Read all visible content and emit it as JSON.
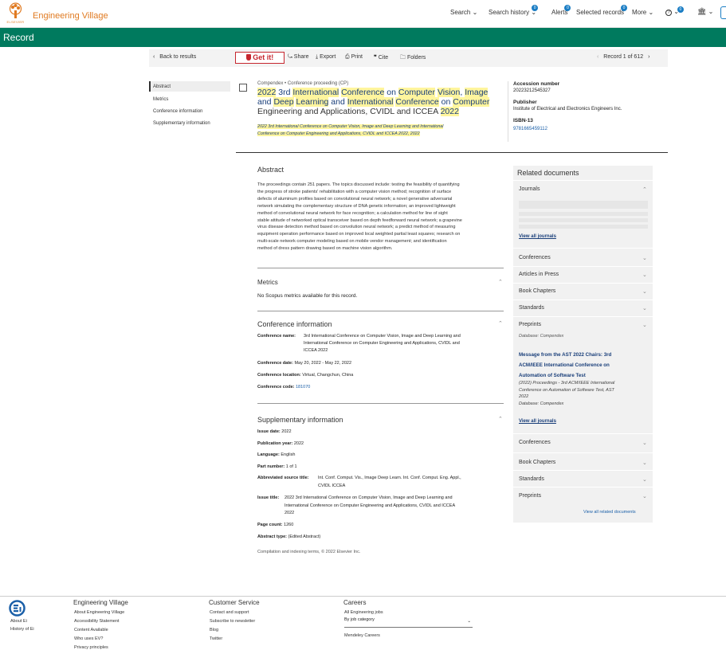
{
  "header": {
    "elsevier_label": "ELSEVIER",
    "brand": "Engineering Village",
    "nav": {
      "search": "Search",
      "search_history": "Search history",
      "alerts": "Alerts",
      "selected_records": "Selected records",
      "more": "More"
    },
    "badges": {
      "search_history": "0",
      "alerts": "0",
      "selected_records": "0",
      "help": "0"
    }
  },
  "page_title": "Record",
  "toolbar": {
    "back": "Back to results",
    "getit": "Get it!",
    "share": "Share",
    "export": "Export",
    "print": "Print",
    "cite": "Cite",
    "folders": "Folders",
    "record_position": "Record 1 of 612"
  },
  "side_nav": [
    "Abstract",
    "Metrics",
    "Conference information",
    "Supplementary information"
  ],
  "record": {
    "source": "Compendex",
    "doc_type": "Conference proceeding (CP)",
    "title_parts": [
      "2022",
      " 3rd ",
      "International",
      " ",
      "Conference",
      " on ",
      "Computer",
      " ",
      "Vision",
      ", ",
      "Image",
      " and ",
      "Deep",
      " ",
      "Learning",
      " and ",
      "International",
      " ",
      "Conference",
      " on ",
      "Computer",
      " Engineering and Applications, CVIDL and ICCEA ",
      "2022"
    ],
    "subtitle_line1": "2022 3rd International Conference on Computer Vision, Image and Deep Learning and International",
    "subtitle_line2": "Conference on Computer Engineering and Applications, CVIDL and ICCEA 2022, 2022"
  },
  "meta": {
    "accession_label": "Accession number",
    "accession_value": "20223212545327",
    "publisher_label": "Publisher",
    "publisher_value": "Institute of Electrical and Electronics Engineers Inc.",
    "isbn_label": "ISBN-13",
    "isbn_value": "9781665459112"
  },
  "abstract": {
    "title": "Abstract",
    "lines": [
      "The proceedings contain 251 papers. The topics discussed include: testing the feasibility of quantifying",
      "the progress of stroke patients' rehabilitation with a computer vision method; recognition of surface",
      "defects of aluminum profiles based on convolutional neural network; a novel generative adversarial",
      "network simulating the complementary structure of DNA genetic information; an improved lightweight",
      "method of convolutional neural network for face recognition; a calculation method for line of sight",
      "stable attitude of networked optical transceiver based on depth feedforward neural network; a grapevine",
      "virus disease detection method based on convolution neural network; a predict method of measuring",
      "equipment operation performance based on improved local weighted partial least squares; research on",
      "multi-scale network computer modeling based on mobile vendor management; and identification",
      "method of dress pattern drawing based on machine vision algorithm."
    ]
  },
  "metrics": {
    "title": "Metrics",
    "text": "No Scopus metrics available for this record."
  },
  "conference": {
    "title": "Conference information",
    "name_label": "Conference name:",
    "name_line1": "3rd International Conference on Computer Vision, Image and Deep Learning and",
    "name_line2": "International Conference on Computer Engineering and Applications, CVIDL and",
    "name_line3": "ICCEA 2022",
    "date_label": "Conference date:",
    "date_value": "May 20, 2022 - May 22, 2022",
    "location_label": "Conference location:",
    "location_value": "Virtual, Changchun, China",
    "code_label": "Conference code:",
    "code_value": "181070"
  },
  "supplementary": {
    "title": "Supplementary information",
    "issue_date_label": "Issue date:",
    "issue_date_value": "2022",
    "pub_year_label": "Publication year:",
    "pub_year_value": "2022",
    "language_label": "Language:",
    "language_value": "English",
    "part_label": "Part number:",
    "part_value": "1 of 1",
    "abbrev_label": "Abbreviated source title:",
    "abbrev_line1": "Int. Conf. Comput. Vis., Image Deep Learn. Int. Conf. Comput. Eng. Appl.,",
    "abbrev_line2": "CVIDL ICCEA",
    "issue_title_label": "Issue title:",
    "issue_title_line1": "2022 3rd International Conference on Computer Vision, Image and Deep Learning and",
    "issue_title_line2": "International Conference on Computer Engineering and Applications, CVIDL and ICCEA",
    "issue_title_line3": "2022",
    "page_count_label": "Page count:",
    "page_count_value": "1260",
    "abstract_type_label": "Abstract type:",
    "abstract_type_value": "(Edited Abstract)",
    "copyright": "Compilation and indexing terms, © 2022 Elsevier Inc."
  },
  "related": {
    "title": "Related documents",
    "journals": "Journals",
    "view_all_journals": "View all journals",
    "conferences": "Conferences",
    "articles_in_press": "Articles in Press",
    "book_chapters": "Book Chapters",
    "standards": "Standards",
    "preprints": "Preprints",
    "db_label": "Database: Compendex",
    "item_title_line1": "Message from the AST 2022 Chairs: 3rd",
    "item_title_line2": "ACM/IEEE International Conference on",
    "item_title_line3": "Automation of Software Test",
    "item_src_line1": "(2022) Proceedings - 3rd ACM/IEEE International",
    "item_src_line2": "Conference on Automation of Software Test, AST",
    "item_src_line3": "2022",
    "item_db": "Database: Compendex",
    "view_all_journals_2": "View all journals",
    "conferences_2": "Conferences",
    "book_chapters_2": "Book Chapters",
    "standards_2": "Standards",
    "preprints_2": "Preprints",
    "view_all_related": "View all related documents"
  },
  "footer": {
    "about_ei": "About Ei",
    "history_ei": "History of Ei",
    "col1_title": "Engineering Village",
    "col1_links": [
      "About Engineering Village",
      "Accessibility Statement",
      "Content Available",
      "Who uses EV?",
      "Privacy principles"
    ],
    "col2_title": "Customer Service",
    "col2_links": [
      "Contact and support",
      "Subscribe to newsletter",
      "Blog",
      "Twitter"
    ],
    "col3_title": "Careers",
    "col3_links": [
      "All Engineering jobs"
    ],
    "col3_select": "By job category",
    "col3_extra": "Mendeley Careers"
  },
  "colors": {
    "brand_green": "#007a5e",
    "brand_orange": "#e07a21",
    "highlight": "#fff59d",
    "link": "#1a5fa8"
  }
}
